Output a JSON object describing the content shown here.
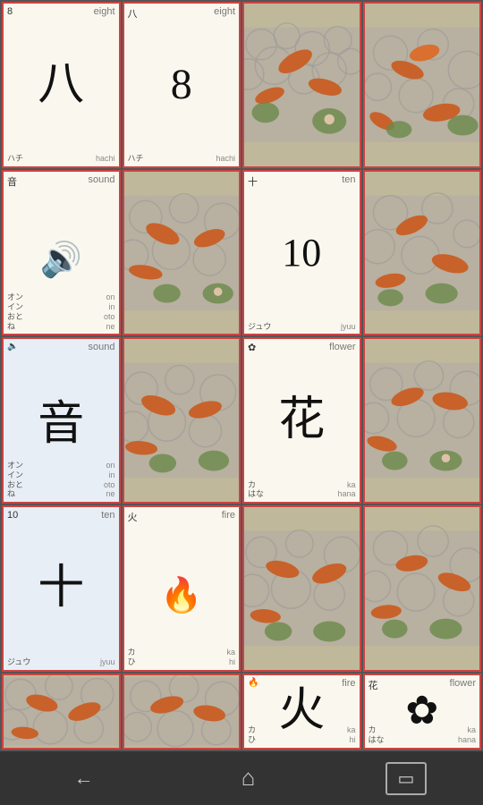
{
  "tiles": [
    {
      "id": "t1",
      "type": "light",
      "tl": "8",
      "tr": "eight",
      "main": "八",
      "bl": "ハチ",
      "br": "hachi",
      "mainSize": "large"
    },
    {
      "id": "t2",
      "type": "light",
      "tl": "八",
      "tr": "eight",
      "main": "8",
      "bl": "ハチ",
      "br": "hachi",
      "mainSize": "large"
    },
    {
      "id": "t3",
      "type": "koi",
      "tl": "",
      "tr": "",
      "main": "",
      "bl": "",
      "br": ""
    },
    {
      "id": "t4",
      "type": "koi",
      "tl": "",
      "tr": "",
      "main": "",
      "bl": "",
      "br": ""
    },
    {
      "id": "t5",
      "type": "light",
      "tl": "音",
      "tr": "sound",
      "main": "🔊",
      "bl": "オン\nイン\nおと\nね",
      "br": "on\nin\noto\nne",
      "mainSize": "icon"
    },
    {
      "id": "t6",
      "type": "koi",
      "tl": "",
      "tr": "",
      "main": "",
      "bl": "",
      "br": ""
    },
    {
      "id": "t7",
      "type": "light",
      "tl": "十",
      "tr": "ten",
      "main": "10",
      "bl": "ジュウ",
      "br": "jyuu",
      "mainSize": "large"
    },
    {
      "id": "t8",
      "type": "koi",
      "tl": "",
      "tr": "",
      "main": "",
      "bl": "",
      "br": ""
    },
    {
      "id": "t9",
      "type": "blue",
      "tl": "🔈",
      "tr": "sound",
      "main": "音",
      "bl": "オン\nイン\nおと\nね",
      "br": "on\nin\noto\nne",
      "mainSize": "large"
    },
    {
      "id": "t10",
      "type": "koi",
      "tl": "",
      "tr": "",
      "main": "",
      "bl": "",
      "br": ""
    },
    {
      "id": "t11",
      "type": "light",
      "tl": "✿",
      "tr": "flower",
      "main": "花",
      "bl": "カ\nはな",
      "br": "ka\nhana",
      "mainSize": "large"
    },
    {
      "id": "t12",
      "type": "koi",
      "tl": "",
      "tr": "",
      "main": "",
      "bl": "",
      "br": ""
    },
    {
      "id": "t13",
      "type": "blue",
      "tl": "10",
      "tr": "ten",
      "main": "十",
      "bl": "ジュウ",
      "br": "jyuu",
      "mainSize": "large"
    },
    {
      "id": "t14",
      "type": "light",
      "tl": "火",
      "tr": "fire",
      "main": "🔥",
      "bl": "カ\nひ",
      "br": "ka\nhi",
      "mainSize": "icon"
    },
    {
      "id": "t15",
      "type": "koi",
      "tl": "",
      "tr": "",
      "main": "",
      "bl": "",
      "br": ""
    },
    {
      "id": "t16",
      "type": "koi",
      "tl": "",
      "tr": "",
      "main": "",
      "bl": "",
      "br": ""
    },
    {
      "id": "t17",
      "type": "koi",
      "tl": "",
      "tr": "",
      "main": "",
      "bl": "",
      "br": ""
    },
    {
      "id": "t18",
      "type": "koi",
      "tl": "",
      "tr": "",
      "main": "",
      "bl": "",
      "br": ""
    },
    {
      "id": "t19",
      "type": "light",
      "tl": "🔥",
      "tr": "fire",
      "main": "火",
      "bl": "カ\nひ",
      "br": "ka\nhi",
      "mainSize": "large"
    },
    {
      "id": "t20",
      "type": "light",
      "tl": "花",
      "tr": "flower",
      "main": "✿",
      "bl": "カ\nはな",
      "br": "ka\nhana",
      "mainSize": "large"
    }
  ],
  "nav": {
    "back": "←",
    "home": "⌂",
    "recent": "▭"
  }
}
